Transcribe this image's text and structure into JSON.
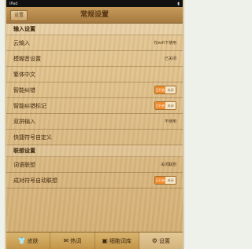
{
  "status": {
    "left": "iPad",
    "right": "▮"
  },
  "header": {
    "back_label": "设置",
    "title": "常规设置"
  },
  "sections": [
    {
      "title": "输入设置",
      "rows": [
        {
          "label": "云输入",
          "value": "仅wifi下使用"
        },
        {
          "label": "模糊音设置",
          "value": "已关闭"
        },
        {
          "label": "繁体中文",
          "value": ""
        },
        {
          "label": "智能纠错",
          "toggle_on": "已开启",
          "toggle_off": "关闭"
        },
        {
          "label": "智能纠错标记",
          "toggle_on": "已开启",
          "toggle_off": "关闭"
        },
        {
          "label": "双拼输入",
          "value": "不使用"
        },
        {
          "label": "快捷符号自定义",
          "value": ""
        }
      ]
    },
    {
      "title": "联想设置",
      "rows": [
        {
          "label": "词语联想",
          "value": "关闭联想"
        },
        {
          "label": "成对符号自动联想",
          "toggle_on": "已开启",
          "toggle_off": "关闭"
        }
      ]
    }
  ],
  "tabs": [
    {
      "label": "皮肤",
      "icon": "shirt-icon"
    },
    {
      "label": "热词",
      "icon": "hot-words-icon"
    },
    {
      "label": "细胞词库",
      "icon": "dictionary-icon"
    },
    {
      "label": "设置",
      "icon": "settings-gear-icon"
    }
  ],
  "colors": {
    "toggle_on": "#ef8a2c",
    "accent": "#5a3714"
  }
}
